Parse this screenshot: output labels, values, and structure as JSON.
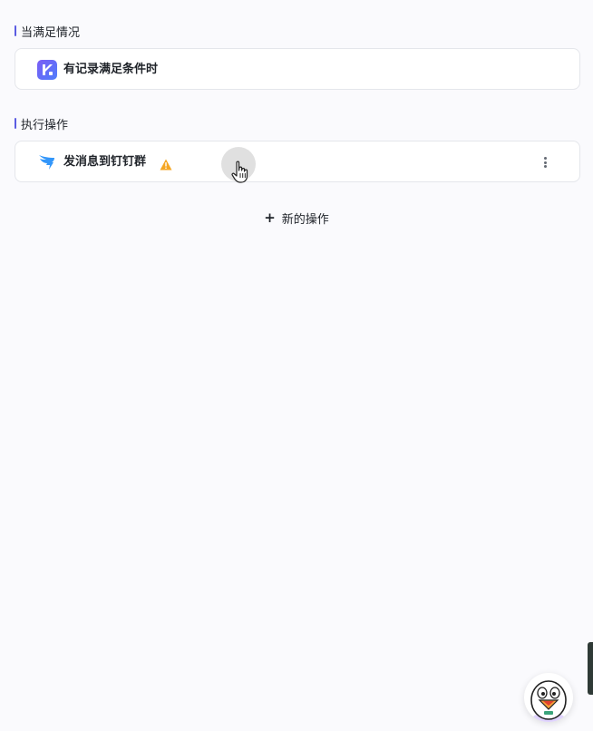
{
  "trigger_section": {
    "title": "当满足情况",
    "card": {
      "label": "有记录满足条件时",
      "icon": "record-app-icon"
    }
  },
  "action_section": {
    "title": "执行操作",
    "card": {
      "label": "发消息到钉钉群",
      "icon": "dingtalk-icon",
      "status_icon": "warning-icon",
      "menu_icon": "more-vertical-icon"
    }
  },
  "add_action": {
    "plus": "+",
    "label": "新的操作"
  },
  "colors": {
    "accent": "#5b5ce2",
    "background": "#fafafd",
    "card_border": "#e4e6eb",
    "warning": "#f5a623",
    "dingtalk": "#3296fa"
  }
}
